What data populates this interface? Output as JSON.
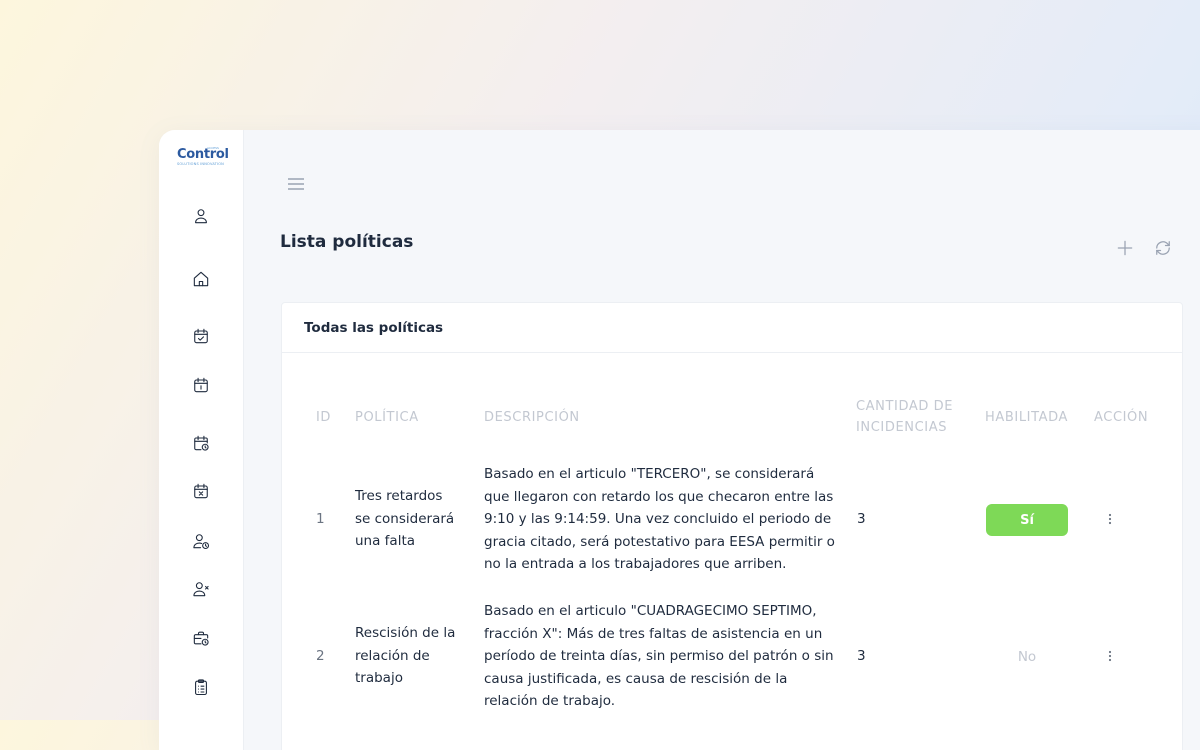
{
  "app": {
    "logo_text": "Control",
    "logo_subtext": "SOLUTIONS INNOVATION",
    "logo_tiny": "ACCESS"
  },
  "sidebar": {
    "items": [
      {
        "icon": "user-icon"
      },
      {
        "icon": "home-icon"
      },
      {
        "icon": "calendar-check-icon"
      },
      {
        "icon": "calendar-one-icon"
      },
      {
        "icon": "calendar-clock-icon"
      },
      {
        "icon": "calendar-x-icon"
      },
      {
        "icon": "user-clock-icon"
      },
      {
        "icon": "user-x-icon"
      },
      {
        "icon": "briefcase-clock-icon"
      },
      {
        "icon": "clipboard-list-icon"
      }
    ]
  },
  "header": {
    "menu_icon": "hamburger-icon",
    "title": "Lista políticas",
    "actions": [
      {
        "icon": "plus-icon"
      },
      {
        "icon": "refresh-icon"
      }
    ]
  },
  "card": {
    "title": "Todas las políticas"
  },
  "table": {
    "columns": {
      "id": "ID",
      "policy": "POLÍTICA",
      "description": "DESCRIPCIÓN",
      "count_line1": "CANTIDAD DE",
      "count_line2": "INCIDENCIAS",
      "enabled": "HABILITADA",
      "action": "ACCIÓN"
    },
    "rows": [
      {
        "id": "1",
        "policy_lines": [
          "Tres retardos",
          "se considerará",
          "una falta"
        ],
        "description_lines": [
          "Basado en el articulo \"TERCERO\", se considerará",
          "que llegaron con retardo los que checaron entre las",
          "9:10 y las 9:14:59. Una vez concluido el periodo de",
          "gracia citado, será potestativo para EESA permitir o",
          "no la entrada a los trabajadores que arriben."
        ],
        "count": "3",
        "enabled": "Sí",
        "enabled_state": true
      },
      {
        "id": "2",
        "policy_lines": [
          "Rescisión de la",
          "relación de",
          "trabajo"
        ],
        "description_lines": [
          "Basado en el articulo \"CUADRAGECIMO SEPTIMO,",
          "fracción X\": Más de tres faltas de asistencia en un",
          "período de treinta días, sin permiso del patrón o sin",
          "causa justificada, es causa de rescisión de la",
          "relación de trabajo."
        ],
        "count": "3",
        "enabled": "No",
        "enabled_state": false
      }
    ]
  },
  "colors": {
    "accent_green": "#7ed957",
    "text_dark": "#1f2b3e",
    "text_muted": "#c3c8d1",
    "logo_blue": "#2c5aa0"
  }
}
